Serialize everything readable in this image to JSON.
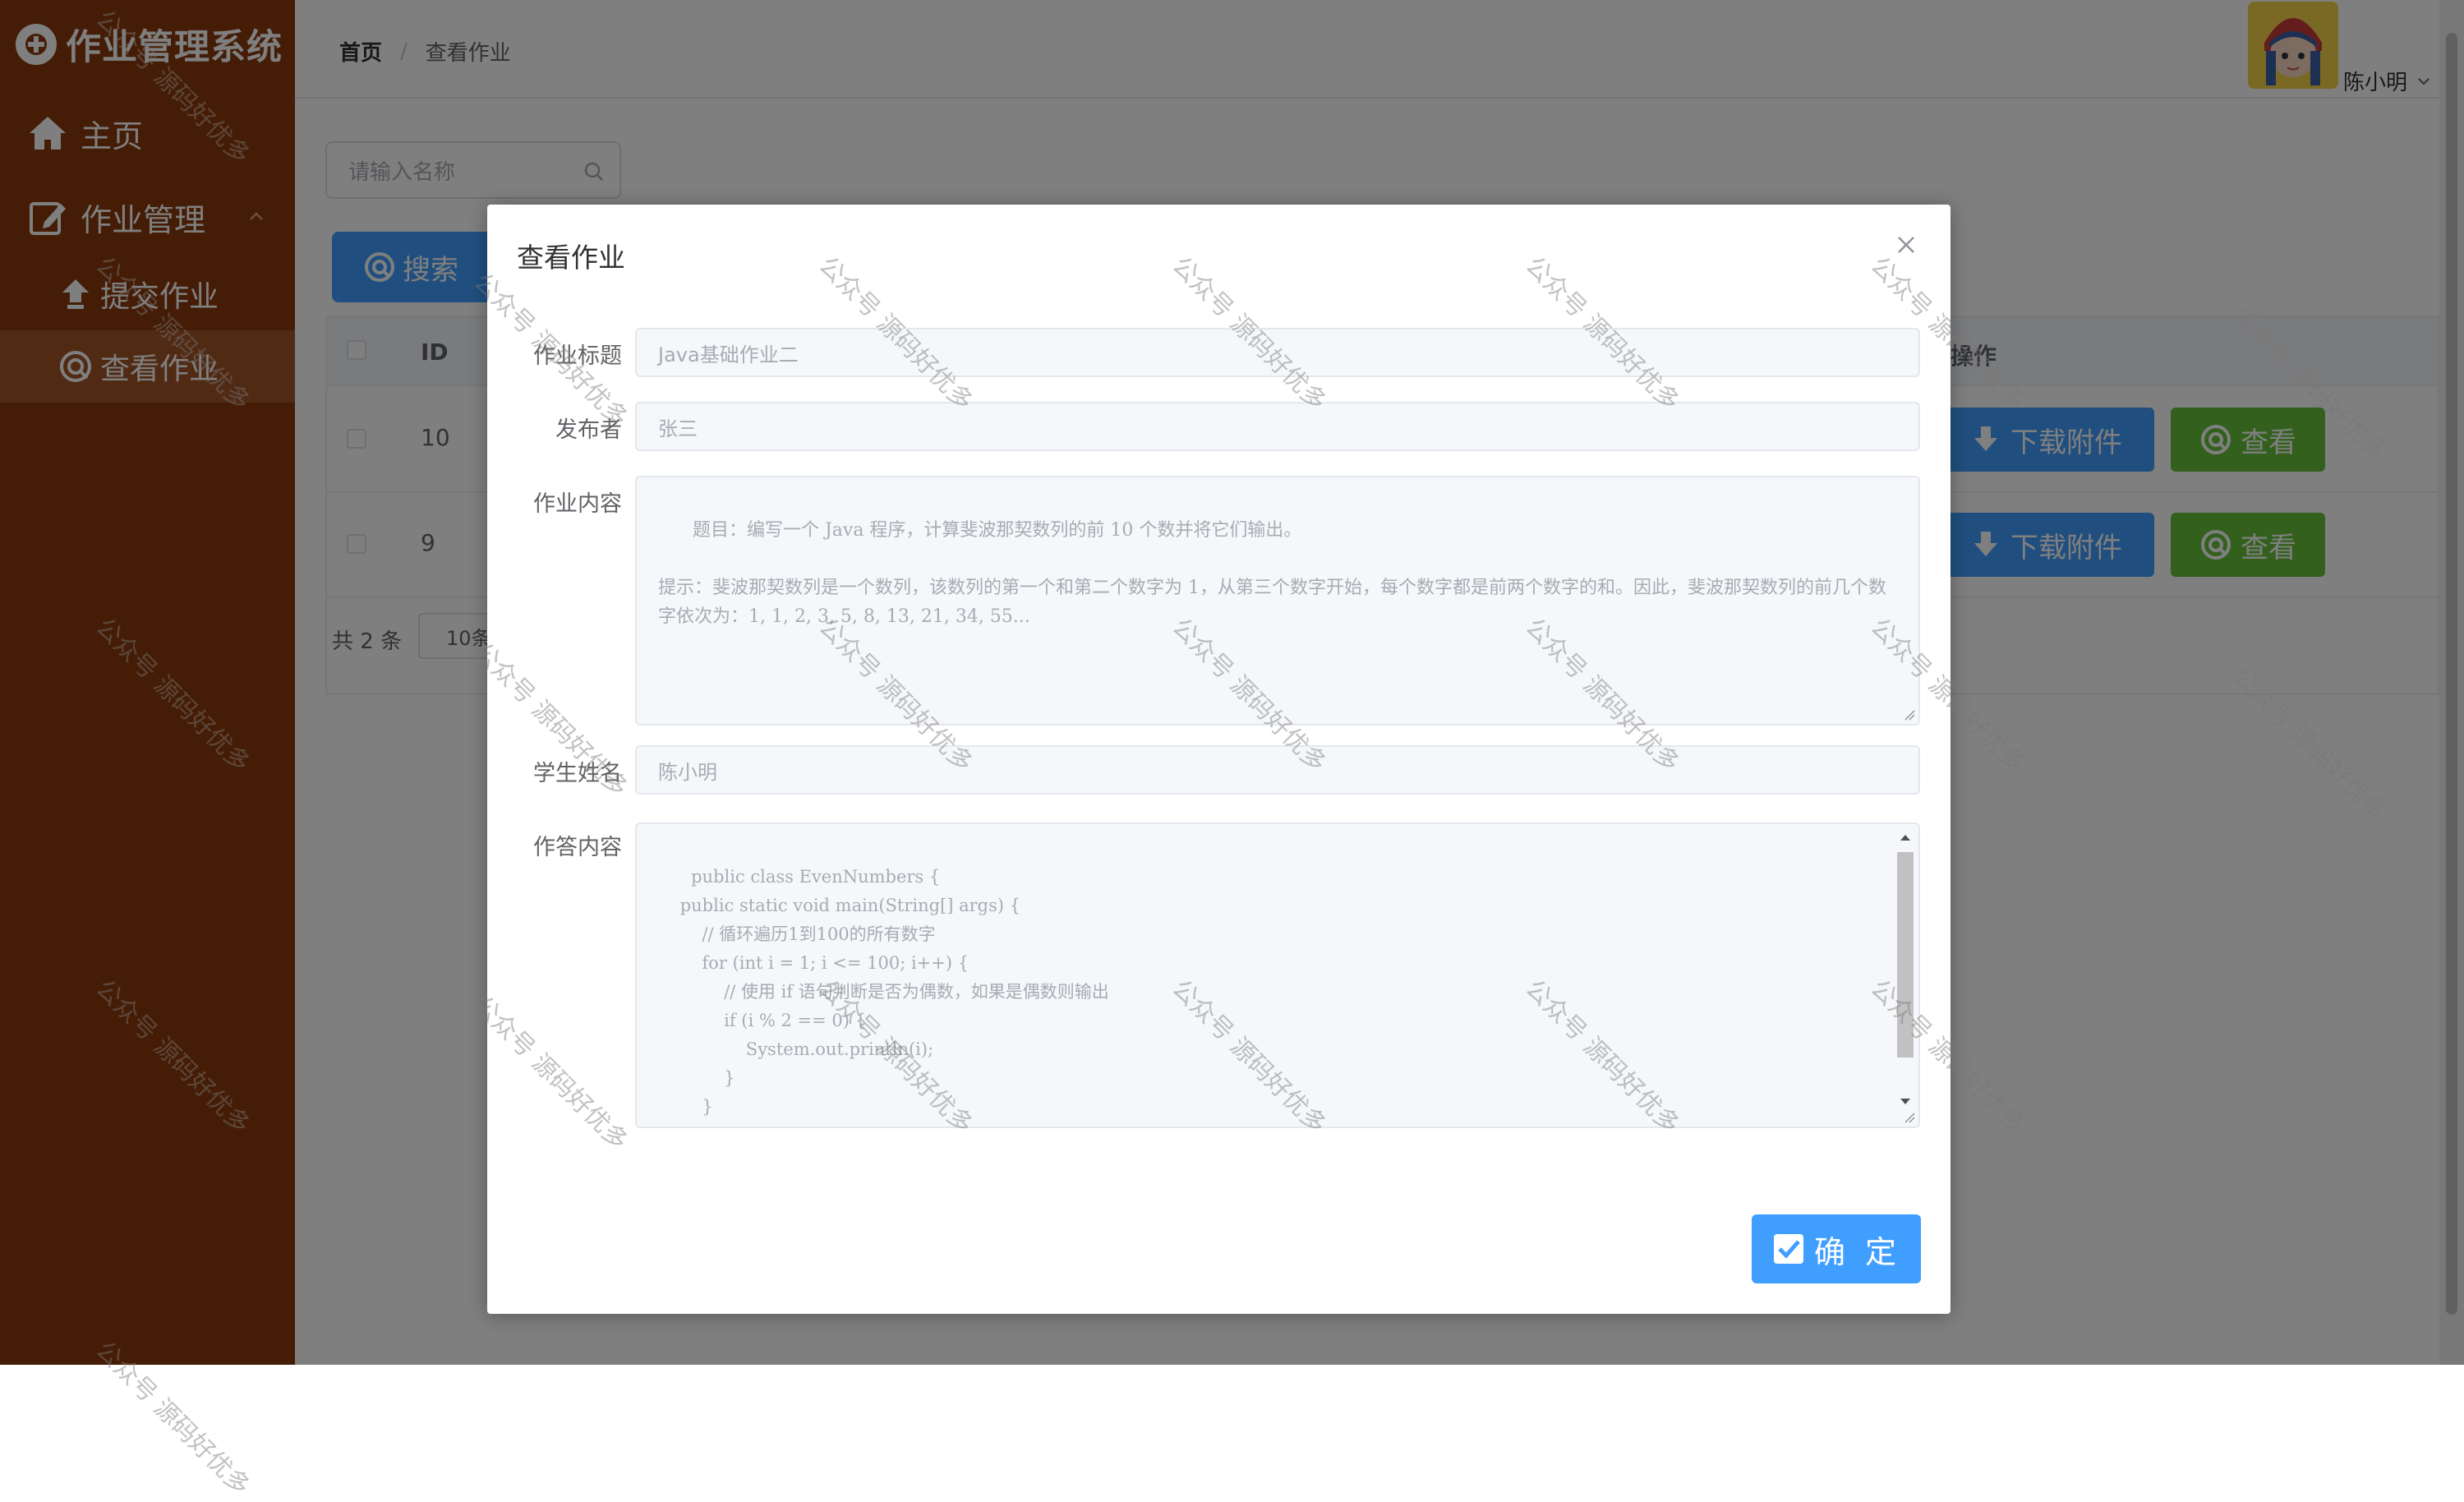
{
  "brand": {
    "title": "作业管理系统"
  },
  "sidebar": {
    "home": "主页",
    "homework_mgmt": "作业管理",
    "submit": "提交作业",
    "view": "查看作业"
  },
  "header": {
    "breadcrumb_home": "首页",
    "breadcrumb_separator": "/",
    "breadcrumb_current": "查看作业",
    "username": "陈小明"
  },
  "main": {
    "search_placeholder": "请输入名称",
    "search_button": "搜索",
    "table": {
      "col_id": "ID",
      "col_ops": "操作",
      "rows": [
        {
          "id": "10",
          "download": "下载附件",
          "view": "查看"
        },
        {
          "id": "9",
          "download": "下载附件",
          "view": "查看"
        }
      ]
    },
    "pagination": {
      "total": "共 2 条",
      "page_size": "10条"
    }
  },
  "dialog": {
    "title": "查看作业",
    "fields": {
      "title_label": "作业标题",
      "title_value": "Java基础作业二",
      "publisher_label": "发布者",
      "publisher_value": "张三",
      "content_label": "作业内容",
      "content_value": "题目：编写一个 Java 程序，计算斐波那契数列的前 10 个数并将它们输出。\n\n提示：斐波那契数列是一个数列，该数列的第一个和第二个数字为 1，从第三个数字开始，每个数字都是前两个数字的和。因此，斐波那契数列的前几个数字依次为：1, 1, 2, 3, 5, 8, 13, 21, 34, 55...",
      "student_label": "学生姓名",
      "student_value": "陈小明",
      "answer_label": "作答内容",
      "answer_value": "public class EvenNumbers {\n    public static void main(String[] args) {\n        // 循环遍历1到100的所有数字\n        for (int i = 1; i <= 100; i++) {\n            // 使用 if 语句判断是否为偶数，如果是偶数则输出\n            if (i % 2 == 0) {\n                System.out.println(i);\n            }\n        }\n    }\n}"
    },
    "confirm_button": "确 定"
  },
  "watermark": {
    "text": "公众号 源码好优多"
  },
  "colors": {
    "sidebar_bg": "#8a3a0c",
    "sidebar_active": "#a25529",
    "primary": "#409eff",
    "success": "#67c23a"
  },
  "icons": [
    "brand-logo-icon",
    "home-icon",
    "edit-icon",
    "chevron-up-icon",
    "upload-icon",
    "view-icon",
    "search-icon",
    "download-icon",
    "close-icon",
    "check-square-icon",
    "chevron-down-icon",
    "avatar"
  ]
}
